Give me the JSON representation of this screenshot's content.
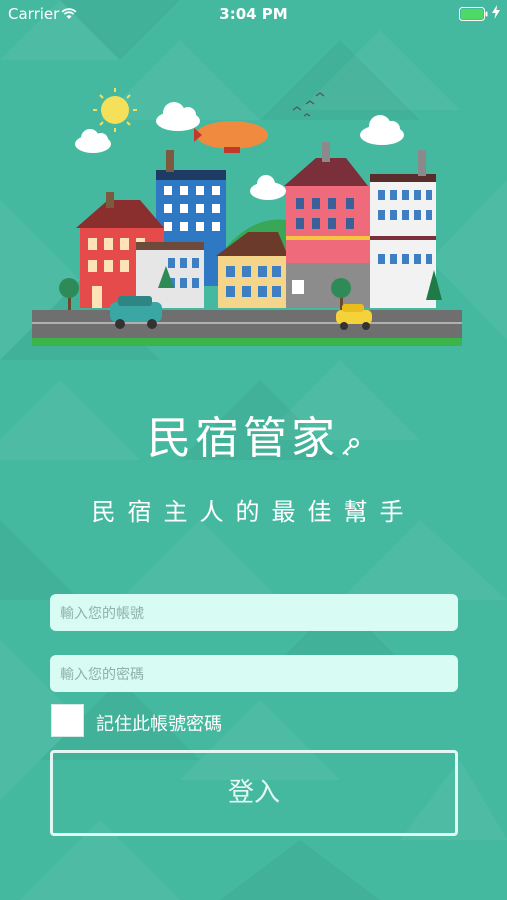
{
  "status_bar": {
    "carrier": "Carrier",
    "time": "3:04 PM"
  },
  "app": {
    "title": "民宿管家",
    "tagline": "民宿主人的最佳幫手"
  },
  "form": {
    "account_placeholder": "輸入您的帳號",
    "password_placeholder": "輸入您的密碼",
    "remember_label": "記住此帳號密碼",
    "remember_checked": false,
    "login_label": "登入"
  },
  "colors": {
    "background": "#45b9a0",
    "field_background": "#d8fbf3",
    "text": "#ffffff"
  },
  "icons": [
    "wifi-icon",
    "battery-icon",
    "charging-icon",
    "key-icon",
    "town-illustration"
  ]
}
